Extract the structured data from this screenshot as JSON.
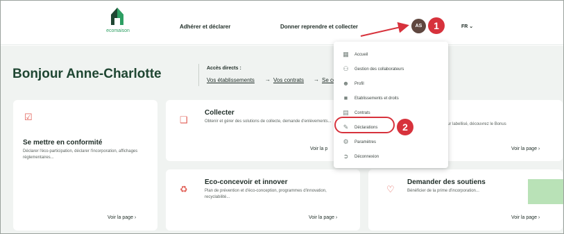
{
  "header": {
    "logo_text": "ecomaison",
    "nav": [
      "Adhérer et déclarer",
      "Donner reprendre et collecter"
    ],
    "avatar_initials": "AS",
    "lang_label": "FR ⌄"
  },
  "annotations": {
    "badge1": "1",
    "badge2": "2"
  },
  "main": {
    "greeting": "Bonjour Anne-Charlotte",
    "acces": {
      "title": "Accès directs :",
      "links": [
        "Vos établissements",
        "Vos contrats",
        "Se co"
      ],
      "arrow": "→"
    }
  },
  "cards": {
    "conformite": {
      "title": "Se mettre en conformité",
      "desc": "Déclarer l'éco-participation, déclarer l'incorporation, affichages réglementaires...",
      "link": "Voir la page  ›",
      "icon": "clipboard-check-icon"
    },
    "collecter": {
      "title": "Collecter",
      "desc": "Obtenir et gérer des solutions de collecte, demande d'enlèvements...",
      "link": "Voir la p",
      "icon": "box-icon"
    },
    "bonus": {
      "desc": "ur labellisé, découvrez le Bonus",
      "link": "Voir la page  ›"
    },
    "eco": {
      "title": "Eco-concevoir et innover",
      "desc": "Plan de prévention et d'éco-conception, programmes d'innovation, recyclabilité...",
      "link": "Voir la page  ›",
      "icon": "recycle-icon"
    },
    "soutiens": {
      "title": "Demander des soutiens",
      "desc": "Bénéficier de la prime d'incorporation...",
      "link": "Voir la page  ›",
      "icon": "heart-icon"
    }
  },
  "dropdown": {
    "items": [
      {
        "label": "Accueil",
        "icon": "grid-icon"
      },
      {
        "label": "Gestion des collaborateurs",
        "icon": "users-icon"
      },
      {
        "label": "Profil",
        "icon": "user-icon"
      },
      {
        "label": "Etablissements et droits",
        "icon": "lock-icon"
      },
      {
        "label": "Contrats",
        "icon": "document-icon"
      },
      {
        "label": "Déclarations",
        "icon": "pencil-icon"
      },
      {
        "label": "Paramètres",
        "icon": "gear-icon"
      },
      {
        "label": "Déconnexion",
        "icon": "logout-icon"
      }
    ]
  },
  "colors": {
    "brand_green": "#2e9f63",
    "dark_green": "#1f4632",
    "annotation_red": "#d7323c",
    "avatar_brown": "#5f473f"
  }
}
